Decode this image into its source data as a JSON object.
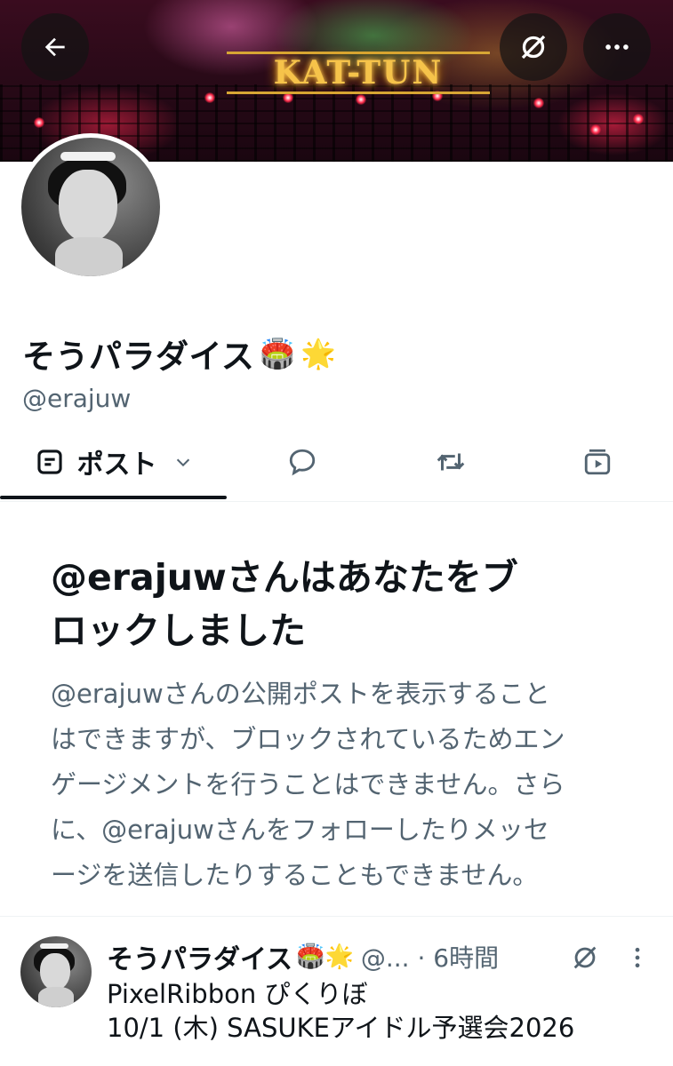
{
  "banner": {
    "sign_text": "KAT-TUN",
    "back_icon": "arrow-left-icon",
    "grok_icon": "grok-slash-icon",
    "more_icon": "ellipsis-icon"
  },
  "profile": {
    "display_name": "そうパラダイス",
    "emojis": [
      "🏟️",
      "🌟"
    ],
    "handle": "@erajuw"
  },
  "tabs": {
    "posts_label": "ポスト",
    "posts_icon": "post-list-icon",
    "dropdown_icon": "chevron-down-icon",
    "replies_icon": "reply-bubble-icon",
    "reposts_icon": "repost-icon",
    "media_icon": "media-play-icon"
  },
  "blocked": {
    "title_line1": "@erajuwさんはあなたをブ",
    "title_line2": "ロックしました",
    "body_lines": [
      "@erajuwさんの公開ポストを表示すること",
      "はできますが、ブロックされているためエン",
      "ゲージメントを行うことはできません。さら",
      "に、@erajuwさんをフォローしたりメッセ",
      "ージを送信したりすることもできません。"
    ]
  },
  "post": {
    "author": "そうパラダイス",
    "emojis": "🏟️🌟",
    "meta": "@... · 6時間",
    "text_lines": [
      "PixelRibbon ぴくりぼ",
      "10/1 (木) SASUKEアイドル予選会2026"
    ]
  },
  "colors": {
    "text_primary": "#0f1419",
    "text_secondary": "#536471",
    "divider": "#eff3f4"
  }
}
